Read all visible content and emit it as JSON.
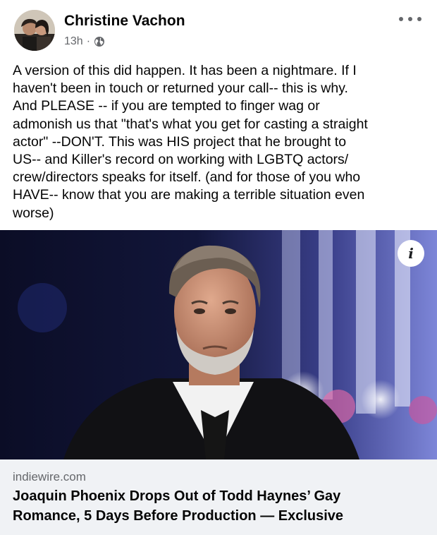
{
  "post": {
    "author": "Christine Vachon",
    "time": "13h",
    "separator": "·",
    "privacy_icon": "globe-icon",
    "more_icon": "more-options-icon",
    "text": "A version of this did happen. It has been a nightmare. If I\nhaven't been in touch or returned your call-- this is why.\nAnd PLEASE -- if you are tempted to finger wag or\nadmonish us that \"that's what you get for casting a straight\nactor\" --DON'T. This was HIS project that he brought to\nUS-- and Killer's record on working with LGBTQ actors/\ncrew/directors speaks for itself. (and for those of you who\nHAVE-- know that you are making a terrible situation even\nworse)"
  },
  "link_preview": {
    "info_icon": "info-icon",
    "info_glyph": "i",
    "domain": "indiewire.com",
    "title": "Joaquin Phoenix Drops Out of Todd Haynes’ Gay Romance, 5 Days Before Production — Exclusive"
  },
  "colors": {
    "text_primary": "#050505",
    "text_secondary": "#65676b",
    "link_footer_bg": "#f0f2f5"
  }
}
